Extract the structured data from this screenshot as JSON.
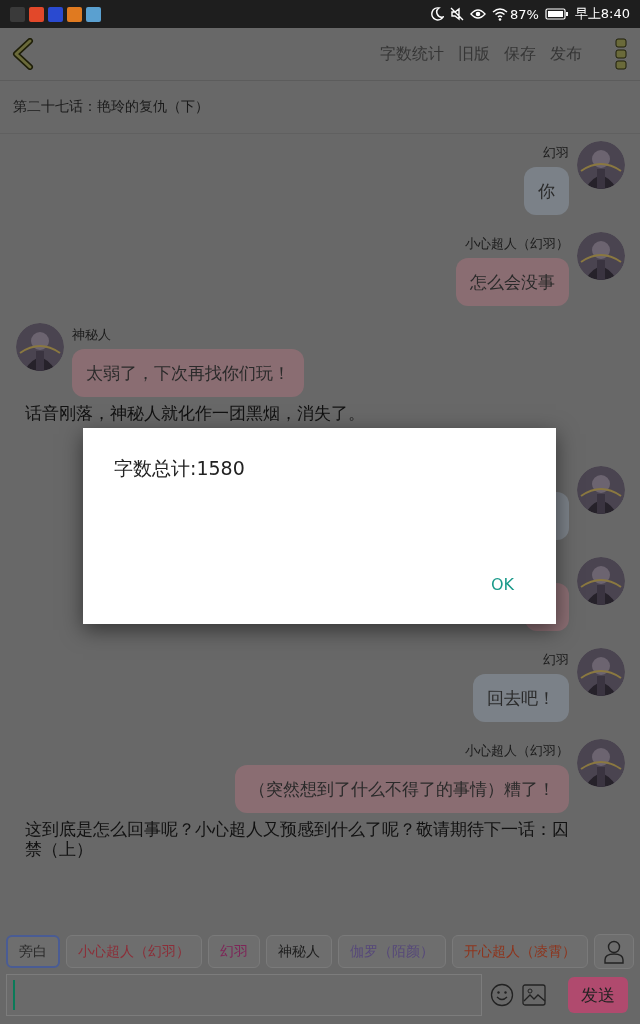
{
  "status_bar": {
    "battery": "87%",
    "time": "早上8:40"
  },
  "toolbar": {
    "actions": [
      "字数统计",
      "旧版",
      "保存",
      "发布"
    ]
  },
  "chapter_title": "第二十七话：艳玲的复仇（下）",
  "messages": [
    {
      "kind": "bubble",
      "outgoing": true,
      "name": "幻羽",
      "text": "你",
      "color": "#7b8188"
    },
    {
      "kind": "bubble",
      "outgoing": true,
      "name": "小心超人（幻羽）",
      "text": "怎么会没事",
      "color": "#8a6d72"
    },
    {
      "kind": "bubble",
      "outgoing": false,
      "name": "神秘人",
      "text": "太弱了，下次再找你们玩！",
      "color": "#8a6d72"
    },
    {
      "kind": "narration",
      "text": "话音刚落，神秘人就化作一团黑烟，消失了。"
    },
    {
      "kind": "bubble",
      "outgoing": true,
      "color": "#7b8188"
    },
    {
      "kind": "bubble",
      "outgoing": true,
      "color": "#8a6d72"
    },
    {
      "kind": "bubble",
      "outgoing": true,
      "name": "幻羽",
      "text": "回去吧！",
      "color": "#7b8188"
    },
    {
      "kind": "bubble",
      "outgoing": true,
      "name": "小心超人（幻羽）",
      "text": "（突然想到了什么不得了的事情）糟了！",
      "color": "#8a6d72"
    },
    {
      "kind": "narration",
      "text": "这到底是怎么回事呢？小心超人又预感到什么了呢？敬请期待下一话：囚禁（上）"
    }
  ],
  "characters": [
    {
      "label": "旁白",
      "selected": true,
      "color": "#2a2a2a"
    },
    {
      "label": "小心超人（幻羽）",
      "selected": false,
      "color": "#8c2e38"
    },
    {
      "label": "幻羽",
      "selected": false,
      "color": "#7e2658"
    },
    {
      "label": "神秘人",
      "selected": false,
      "color": "#1e1e1e"
    },
    {
      "label": "伽罗（陌颜）",
      "selected": false,
      "color": "#56487a"
    },
    {
      "label": "开心超人（凌霄）",
      "selected": false,
      "color": "#8e341c"
    }
  ],
  "composer": {
    "focused": true,
    "send": "发送"
  },
  "dialog": {
    "message": "字数总计:1580",
    "button": "OK"
  }
}
